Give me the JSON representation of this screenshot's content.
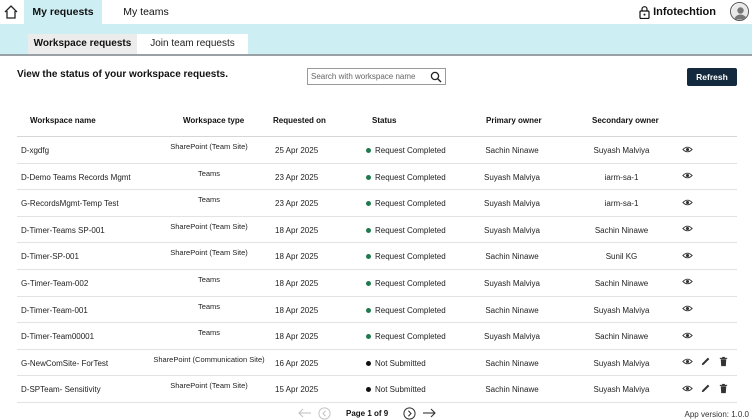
{
  "nav": {
    "tabs": [
      {
        "label": "My requests",
        "active": true
      },
      {
        "label": "My teams",
        "active": false
      }
    ],
    "brand": "Infotechtion"
  },
  "subtabs": [
    {
      "label": "Workspace requests",
      "active": true
    },
    {
      "label": "Join team requests",
      "active": false
    }
  ],
  "toolbar": {
    "heading": "View the status of your workspace requests.",
    "search_placeholder": "Search with workspace name",
    "refresh_label": "Refresh"
  },
  "table": {
    "columns": [
      "Workspace name",
      "Workspace type",
      "Requested on",
      "Status",
      "Primary owner",
      "Secondary owner"
    ],
    "rows": [
      {
        "name": "D-xgdfg",
        "type": "SharePoint (Team Site)",
        "date": "25 Apr 2025",
        "status": "Request Completed",
        "status_kind": "completed",
        "primary": "Sachin Ninawe",
        "secondary": "Suyash Malviya",
        "actions": [
          "view"
        ]
      },
      {
        "name": "D-Demo Teams Records Mgmt",
        "type": "Teams",
        "date": "23 Apr 2025",
        "status": "Request Completed",
        "status_kind": "completed",
        "primary": "Suyash Malviya",
        "secondary": "iarm-sa-1",
        "actions": [
          "view"
        ]
      },
      {
        "name": "G-RecordsMgmt-Temp Test",
        "type": "Teams",
        "date": "23 Apr 2025",
        "status": "Request Completed",
        "status_kind": "completed",
        "primary": "Suyash Malviya",
        "secondary": "iarm-sa-1",
        "actions": [
          "view"
        ]
      },
      {
        "name": "D-Timer-Teams SP-001",
        "type": "SharePoint (Team Site)",
        "date": "18 Apr 2025",
        "status": "Request Completed",
        "status_kind": "completed",
        "primary": "Suyash Malviya",
        "secondary": "Sachin Ninawe",
        "actions": [
          "view"
        ]
      },
      {
        "name": "D-Timer-SP-001",
        "type": "SharePoint (Team Site)",
        "date": "18 Apr 2025",
        "status": "Request Completed",
        "status_kind": "completed",
        "primary": "Sachin Ninawe",
        "secondary": "Sunil KG",
        "actions": [
          "view"
        ]
      },
      {
        "name": "G-Timer-Team-002",
        "type": "Teams",
        "date": "18 Apr 2025",
        "status": "Request Completed",
        "status_kind": "completed",
        "primary": "Suyash Malviya",
        "secondary": "Sachin Ninawe",
        "actions": [
          "view"
        ]
      },
      {
        "name": "D-Timer-Team-001",
        "type": "Teams",
        "date": "18 Apr 2025",
        "status": "Request Completed",
        "status_kind": "completed",
        "primary": "Sachin Ninawe",
        "secondary": "Suyash Malviya",
        "actions": [
          "view"
        ]
      },
      {
        "name": "D-Timer-Team00001",
        "type": "Teams",
        "date": "18 Apr 2025",
        "status": "Request Completed",
        "status_kind": "completed",
        "primary": "Suyash Malviya",
        "secondary": "Sachin Ninawe",
        "actions": [
          "view"
        ]
      },
      {
        "name": "G-NewComSite- ForTest",
        "type": "SharePoint (Communication Site)",
        "date": "16 Apr 2025",
        "status": "Not Submitted",
        "status_kind": "not_submitted",
        "primary": "Sachin Ninawe",
        "secondary": "Suyash Malviya",
        "actions": [
          "view",
          "edit",
          "delete"
        ]
      },
      {
        "name": "D-SPTeam- Sensitivity",
        "type": "SharePoint (Team Site)",
        "date": "15 Apr 2025",
        "status": "Not Submitted",
        "status_kind": "not_submitted",
        "primary": "Sachin Ninawe",
        "secondary": "Suyash Malviya",
        "actions": [
          "view",
          "edit",
          "delete"
        ]
      }
    ]
  },
  "pagination": {
    "label": "Page 1 of 9"
  },
  "footer": {
    "version": "App version: 1.0.0"
  },
  "colors": {
    "accent_band": "#cdeef2",
    "primary_button": "#13293d",
    "status_completed": "#1f7a4d",
    "status_not_submitted": "#111111"
  },
  "icons": {
    "home": "home-icon",
    "brand": "lock-icon",
    "avatar": "user-avatar-icon",
    "search": "search-icon",
    "view": "eye-icon",
    "edit": "pencil-icon",
    "delete": "trash-icon",
    "first_page": "double-chevron-left-icon",
    "prev_page": "arrow-left-circle-icon",
    "next_page": "arrow-right-circle-icon",
    "last_page": "arrow-right-icon"
  }
}
